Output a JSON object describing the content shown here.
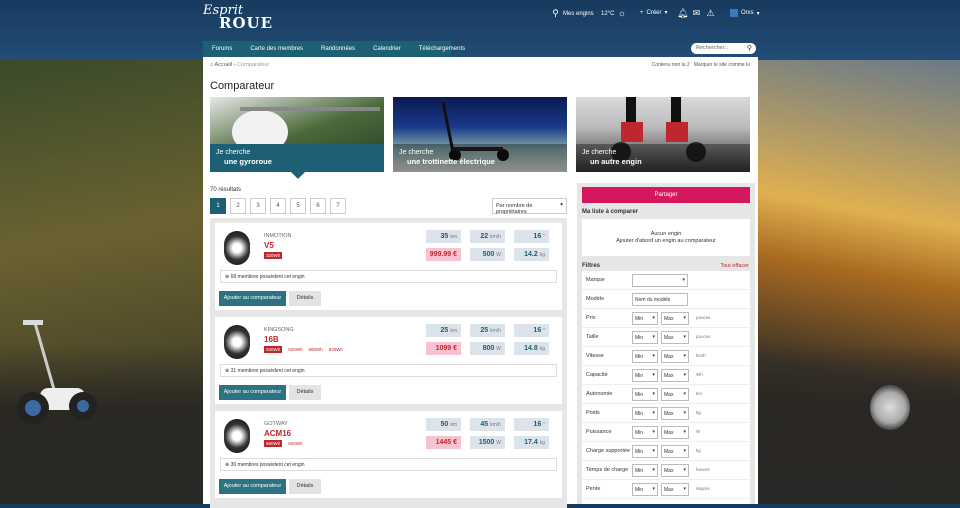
{
  "header": {
    "logo": "Esprit Roue",
    "logo_line1": "Esprit",
    "logo_line2": "ROUE",
    "mes_engins": "Mes engins",
    "temperature": "12°C",
    "creer": "Créer",
    "user": "Orxs"
  },
  "nav": [
    "Forums",
    "Carte des membres",
    "Randonnées",
    "Calendrier",
    "Téléchargements"
  ],
  "search": {
    "placeholder": "Rechercher..."
  },
  "breadcrumb": {
    "home": "Accueil",
    "current": "Comparateur",
    "right1": "Contenu non lu 2",
    "right2": "Marquer le site comme lu"
  },
  "page_title": "Comparateur",
  "heroes": [
    {
      "line1": "Je cherche",
      "line2": "une gyroroue"
    },
    {
      "line1": "Je cherche",
      "line2": "une trottinette électrique"
    },
    {
      "line1": "Je cherche",
      "line2": "un autre engin"
    }
  ],
  "results_count": "70 résultats",
  "pages": [
    "1",
    "2",
    "3",
    "4",
    "5",
    "6",
    "7"
  ],
  "sort": {
    "label": "Par nombre de propriétaires"
  },
  "items": [
    {
      "brand": "INMOTION",
      "model": "V5",
      "batteries": [
        "320Wh"
      ],
      "speed": "35",
      "speed_u": "km",
      "range": "22",
      "range_u": "km/h",
      "height": "16",
      "height_u": "\"",
      "price": "999.99 €",
      "power": "500",
      "power_u": "W",
      "weight": "14.2",
      "weight_u": "kg",
      "owners": "68 membres possèdent cet engin",
      "btn_compare": "Ajouter au comparateur",
      "btn_details": "Détails"
    },
    {
      "brand": "KINGSONG",
      "model": "16B",
      "batteries": [
        "340Wh",
        "520Wh",
        "680Wh",
        "840Wh"
      ],
      "speed": "25",
      "speed_u": "km",
      "range": "25",
      "range_u": "km/h",
      "height": "16",
      "height_u": "\"",
      "price": "1099 €",
      "power": "800",
      "power_u": "W",
      "weight": "14.8",
      "weight_u": "kg",
      "owners": "31 membres possèdent cet engin",
      "btn_compare": "Ajouter au comparateur",
      "btn_details": "Détails"
    },
    {
      "brand": "GOTWAY",
      "model": "ACM16",
      "batteries": [
        "680Wh",
        "820Wh"
      ],
      "speed": "50",
      "speed_u": "km",
      "range": "45",
      "range_u": "km/h",
      "height": "16",
      "height_u": "\"",
      "price": "1445 €",
      "power": "1500",
      "power_u": "W",
      "weight": "17.4",
      "weight_u": "kg",
      "owners": "30 membres possèdent cet engin",
      "btn_compare": "Ajouter au comparateur",
      "btn_details": "Détails"
    }
  ],
  "sidebar": {
    "share": "Partager",
    "list_title": "Ma liste à comparer",
    "empty1": "Aucun engin",
    "empty2": "Ajouter d'abord un engin au comparateur",
    "filters_title": "Filtres",
    "clear": "Tout effacer",
    "filters": [
      {
        "label": "Marque",
        "type": "select"
      },
      {
        "label": "Modèle",
        "type": "text",
        "placeholder": "Nom du modèle"
      },
      {
        "label": "Prix",
        "type": "range",
        "min": "Min",
        "max": "Max",
        "unit": "pouces"
      },
      {
        "label": "Taille",
        "type": "range",
        "min": "Min",
        "max": "Max",
        "unit": "pouces"
      },
      {
        "label": "Vitesse",
        "type": "range",
        "min": "Min",
        "max": "Max",
        "unit": "km/h"
      },
      {
        "label": "Capacité",
        "type": "range",
        "min": "Min",
        "max": "Max",
        "unit": "Wh"
      },
      {
        "label": "Autonomie",
        "type": "range",
        "min": "Min",
        "max": "Max",
        "unit": "km"
      },
      {
        "label": "Poids",
        "type": "range",
        "min": "Min",
        "max": "Max",
        "unit": "kg"
      },
      {
        "label": "Puissance",
        "type": "range",
        "min": "Min",
        "max": "Max",
        "unit": "W"
      },
      {
        "label": "Charge supportée",
        "type": "range",
        "min": "Min",
        "max": "Max",
        "unit": "kg"
      },
      {
        "label": "Temps de charge",
        "type": "range",
        "min": "Min",
        "max": "Max",
        "unit": "heures"
      },
      {
        "label": "Pente",
        "type": "range",
        "min": "Min",
        "max": "Max",
        "unit": "degrés"
      }
    ]
  }
}
